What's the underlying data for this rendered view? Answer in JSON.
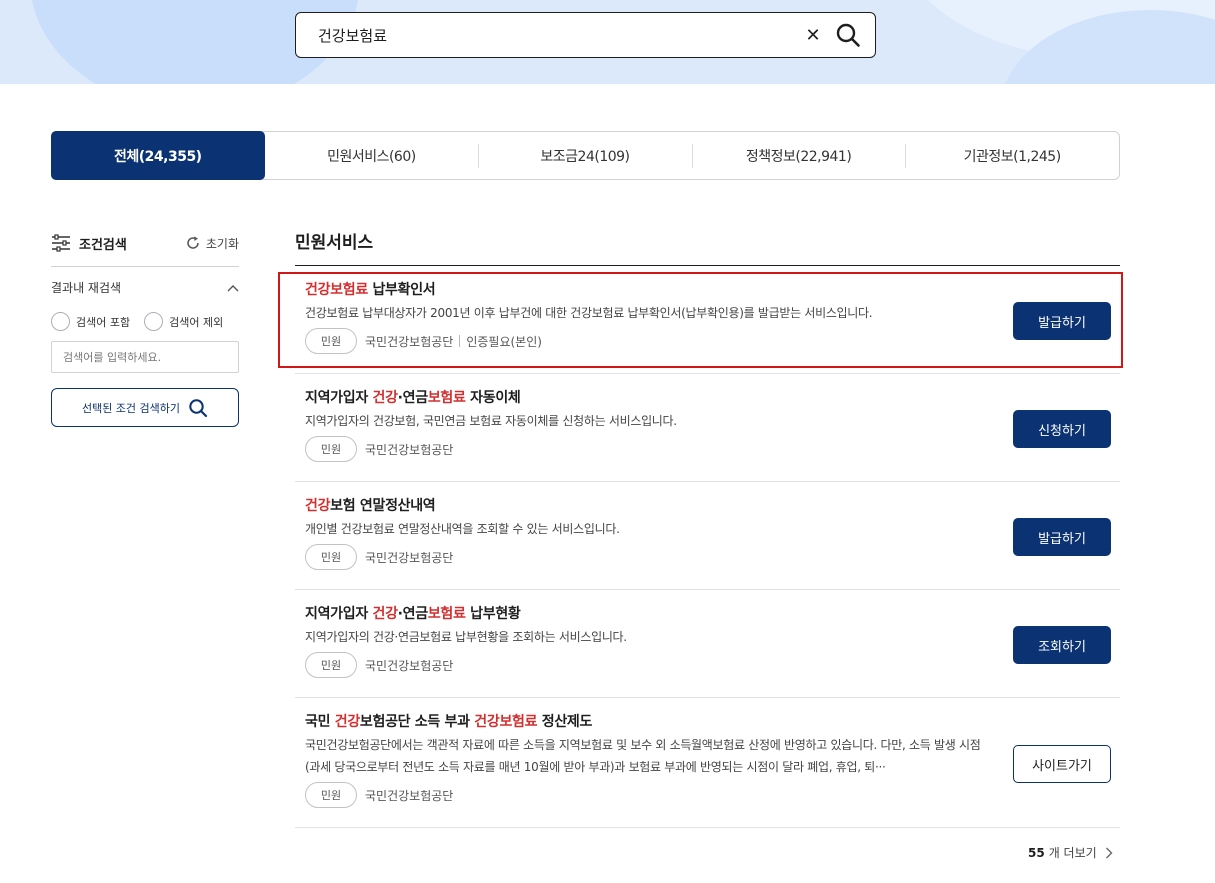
{
  "search": {
    "query": "건강보험료"
  },
  "tabs": [
    {
      "label": "전체(24,355)",
      "active": true
    },
    {
      "label": "민원서비스(60)"
    },
    {
      "label": "보조금24(109)"
    },
    {
      "label": "정책정보(22,941)"
    },
    {
      "label": "기관정보(1,245)"
    }
  ],
  "sidebar": {
    "title": "조건검색",
    "reset_label": "초기화",
    "refine_label": "결과내 재검색",
    "radio_include": "검색어 포함",
    "radio_exclude": "검색어 제외",
    "input_placeholder": "검색어를 입력하세요.",
    "apply_button": "선택된 조건 검색하기"
  },
  "main": {
    "section_title": "민원서비스",
    "items": [
      {
        "title_parts": [
          {
            "t": "건강보험료",
            "hl": true
          },
          {
            "t": " 납부확인서"
          }
        ],
        "desc": "건강보험료 납부대상자가 2001년 이후 납부건에 대한 건강보험료 납부확인서(납부확인용)를 발급받는 서비스입니다.",
        "badge": "민원",
        "agency": "국민건강보험공단",
        "extra": "인증필요(본인)",
        "button": "발급하기"
      },
      {
        "title_parts": [
          {
            "t": "지역가입자 "
          },
          {
            "t": "건강",
            "hl": true
          },
          {
            "t": "·연금"
          },
          {
            "t": "보험료",
            "hl": true
          },
          {
            "t": " 자동이체"
          }
        ],
        "desc": "지역가입자의 건강보험, 국민연금 보험료 자동이체를 신청하는 서비스입니다.",
        "badge": "민원",
        "agency": "국민건강보험공단",
        "button": "신청하기"
      },
      {
        "title_parts": [
          {
            "t": "건강",
            "hl": true
          },
          {
            "t": "보험 연말정산내역"
          }
        ],
        "desc": "개인별 건강보험료 연말정산내역을 조회할 수 있는 서비스입니다.",
        "badge": "민원",
        "agency": "국민건강보험공단",
        "button": "발급하기"
      },
      {
        "title_parts": [
          {
            "t": "지역가입자 "
          },
          {
            "t": "건강",
            "hl": true
          },
          {
            "t": "·연금"
          },
          {
            "t": "보험료",
            "hl": true
          },
          {
            "t": " 납부현황"
          }
        ],
        "desc": "지역가입자의 건강·연금보험료 납부현황을 조회하는 서비스입니다.",
        "badge": "민원",
        "agency": "국민건강보험공단",
        "button": "조회하기"
      },
      {
        "title_parts": [
          {
            "t": "국민 "
          },
          {
            "t": "건강",
            "hl": true
          },
          {
            "t": "보험공단 소득 부과 "
          },
          {
            "t": "건강보험료",
            "hl": true
          },
          {
            "t": " 정산제도"
          }
        ],
        "desc": "국민건강보험공단에서는 객관적 자료에 따른 소득을 지역보험료 및 보수 외 소득월액보험료 산정에 반영하고 있습니다. 다만, 소득 발생 시점(과세 당국으로부터 전년도 소득 자료를 매년 10월에 받아 부과)과 보험료 부과에 반영되는 시점이 달라 폐업, 휴업, 퇴···",
        "badge": "민원",
        "agency": "국민건강보험공단",
        "button": "사이트가기",
        "button_style": "outline"
      }
    ],
    "more_count": "55",
    "more_label": "개 더보기"
  },
  "colors": {
    "primary": "#0b3272",
    "highlight": "#d32f2f",
    "focus_border": "#d01818",
    "hero_bg": "#dbe9fb"
  }
}
